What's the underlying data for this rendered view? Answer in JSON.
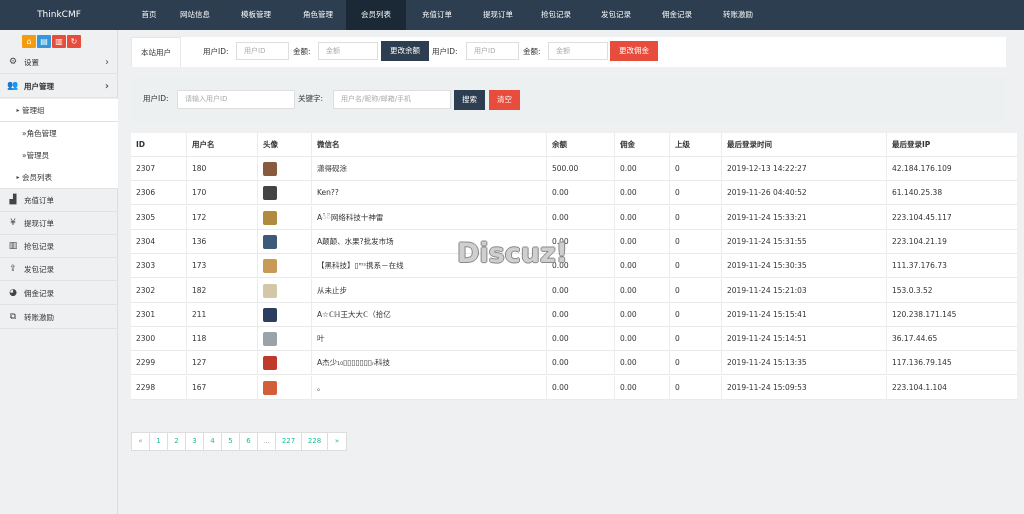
{
  "app": {
    "brand": "ThinkCMF"
  },
  "topnav": [
    {
      "label": "首页"
    },
    {
      "label": "网站信息"
    },
    {
      "label": "模板管理"
    },
    {
      "label": "角色管理"
    },
    {
      "label": "会员列表"
    },
    {
      "label": "充值订单"
    },
    {
      "label": "提现订单"
    },
    {
      "label": "抢包记录"
    },
    {
      "label": "发包记录"
    },
    {
      "label": "佣金记录"
    },
    {
      "label": "转账激励"
    }
  ],
  "sidebar": {
    "tools": [
      {
        "icon": "home-icon",
        "glyph": "⌂",
        "color": "#f39c12"
      },
      {
        "icon": "document-icon",
        "glyph": "▤",
        "color": "#3498db"
      },
      {
        "icon": "trash-icon",
        "glyph": "▥",
        "color": "#e74c3c"
      },
      {
        "icon": "refresh-icon",
        "glyph": "↻",
        "color": "#e74c3c"
      }
    ],
    "settings": "设置",
    "user_mgmt": "用户管理",
    "admin_group": "管理组",
    "role_mgmt": "»角色管理",
    "admins": "»管理员",
    "member_list": "会员列表",
    "items": [
      {
        "label": "充值订单",
        "icon": "chart-icon",
        "glyph": "▟"
      },
      {
        "label": "提现订单",
        "icon": "yen-icon",
        "glyph": "¥"
      },
      {
        "label": "抢包记录",
        "icon": "bar-chart-icon",
        "glyph": "▥"
      },
      {
        "label": "发包记录",
        "icon": "upload-icon",
        "glyph": "⇪"
      },
      {
        "label": "佣金记录",
        "icon": "pie-chart-icon",
        "glyph": "◕"
      },
      {
        "label": "转账激励",
        "icon": "transfer-icon",
        "glyph": "⧉"
      }
    ]
  },
  "edit_panel": {
    "tab": "本站用户",
    "user_id_label": "用户ID:",
    "user_id_placeholder": "用户ID",
    "amount_label": "金额:",
    "amount_placeholder": "金额",
    "btn_balance": "更改余额",
    "btn_commission": "更改佣金"
  },
  "search": {
    "user_id_label": "用户ID:",
    "user_id_placeholder": "请输入用户ID",
    "keyword_label": "关键字:",
    "keyword_placeholder": "用户名/昵称/邮箱/手机",
    "btn_search": "搜索",
    "btn_clear": "清空"
  },
  "table": {
    "columns": [
      "ID",
      "用户名",
      "头像",
      "微信名",
      "余额",
      "佣金",
      "上级",
      "最后登录时间",
      "最后登录IP"
    ],
    "rows": [
      {
        "id": "2307",
        "user": "180",
        "avatar": "#8a5a3c",
        "wx": "潇得砚涂",
        "balance": "500.00",
        "commission": "0.00",
        "parent": "0",
        "time": "2019-12-13 14:22:27",
        "ip": "42.184.176.109"
      },
      {
        "id": "2306",
        "user": "170",
        "avatar": "#444444",
        "wx": "Ken??",
        "balance": "0.00",
        "commission": "0.00",
        "parent": "0",
        "time": "2019-11-26 04:40:52",
        "ip": "61.140.25.38"
      },
      {
        "id": "2305",
        "user": "172",
        "avatar": "#b28a3e",
        "wx": "A៉៉网络科技十神雷",
        "balance": "0.00",
        "commission": "0.00",
        "parent": "0",
        "time": "2019-11-24 15:33:21",
        "ip": "223.104.45.117"
      },
      {
        "id": "2304",
        "user": "136",
        "avatar": "#3d5a7a",
        "wx": "A颠颠、水果?批发市场",
        "balance": "0.00",
        "commission": "0.00",
        "parent": "0",
        "time": "2019-11-24 15:31:55",
        "ip": "223.104.21.19"
      },
      {
        "id": "2303",
        "user": "173",
        "avatar": "#c99a55",
        "wx": "【黑科技】▯ᵐˢ携系－在线",
        "balance": "0.00",
        "commission": "0.00",
        "parent": "0",
        "time": "2019-11-24 15:30:35",
        "ip": "111.37.176.73"
      },
      {
        "id": "2302",
        "user": "182",
        "avatar": "#d4c6a8",
        "wx": "从未止步",
        "balance": "0.00",
        "commission": "0.00",
        "parent": "0",
        "time": "2019-11-24 15:21:03",
        "ip": "153.0.3.52"
      },
      {
        "id": "2301",
        "user": "211",
        "avatar": "#2c3e60",
        "wx": "A☆ℂℍ王大大ℂ（拾亿",
        "balance": "0.00",
        "commission": "0.00",
        "parent": "0",
        "time": "2019-11-24 15:15:41",
        "ip": "120.238.171.145"
      },
      {
        "id": "2300",
        "user": "118",
        "avatar": "#9aa2aa",
        "wx": "叶",
        "balance": "0.00",
        "commission": "0.00",
        "parent": "0",
        "time": "2019-11-24 15:14:51",
        "ip": "36.17.44.65"
      },
      {
        "id": "2299",
        "user": "127",
        "avatar": "#c0392b",
        "wx": "A杰少₁₀▯▯▯▯▯▯▯ₙ科技",
        "balance": "0.00",
        "commission": "0.00",
        "parent": "0",
        "time": "2019-11-24 15:13:35",
        "ip": "117.136.79.145"
      },
      {
        "id": "2298",
        "user": "167",
        "avatar": "#d35f3a",
        "wx": "。",
        "balance": "0.00",
        "commission": "0.00",
        "parent": "0",
        "time": "2019-11-24 15:09:53",
        "ip": "223.104.1.104"
      }
    ]
  },
  "watermark": "Discuz!",
  "pagination": [
    "«",
    "1",
    "2",
    "3",
    "4",
    "5",
    "6",
    "...",
    "227",
    "228",
    "»"
  ]
}
